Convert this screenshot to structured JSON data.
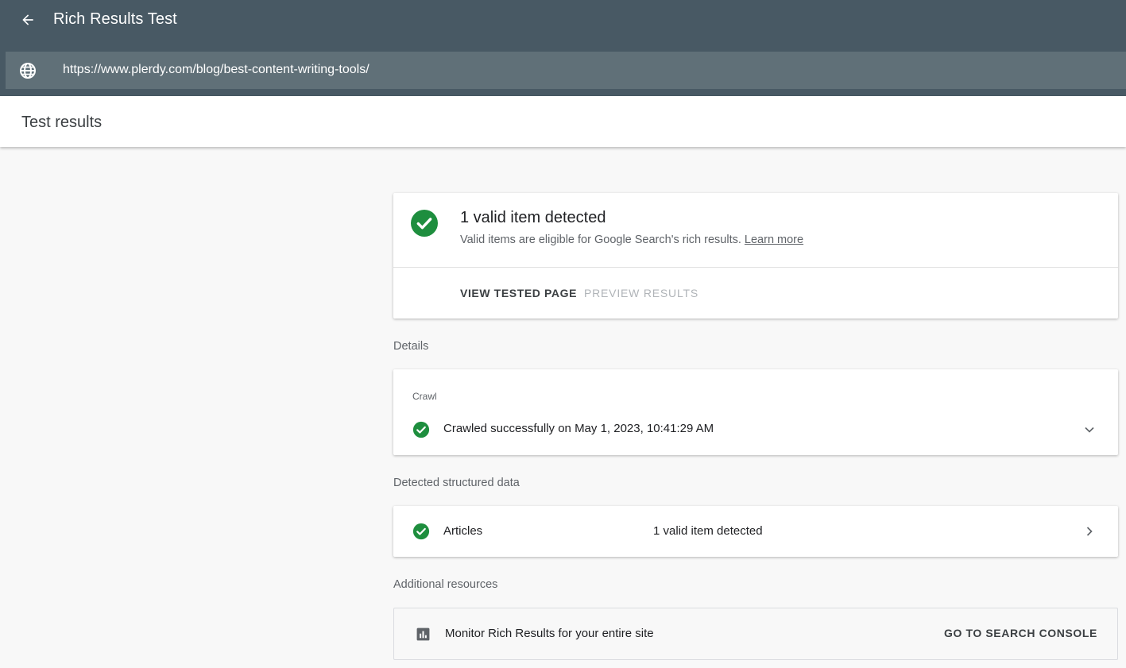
{
  "header": {
    "back_icon": "arrow-back-icon",
    "title": "Rich Results Test",
    "url_icon": "globe-icon",
    "url": "https://www.plerdy.com/blog/best-content-writing-tools/"
  },
  "subheader": {
    "title": "Test results"
  },
  "summary": {
    "icon": "check-circle-icon",
    "title": "1 valid item detected",
    "subtitle": "Valid items are eligible for Google Search's rich results.",
    "learn_more": "Learn more",
    "tabs": [
      {
        "label": "VIEW TESTED PAGE",
        "active": true
      },
      {
        "label": "PREVIEW RESULTS",
        "active": false
      }
    ]
  },
  "details": {
    "section_label": "Details",
    "crawl_label": "Crawl",
    "crawl_status": "Crawled successfully on May 1, 2023, 10:41:29 AM",
    "expand_icon": "chevron-down-icon"
  },
  "structured_data": {
    "section_label": "Detected structured data",
    "items": [
      {
        "type": "Articles",
        "status": "1 valid item detected"
      }
    ],
    "open_icon": "chevron-right-icon"
  },
  "resources": {
    "section_label": "Additional resources",
    "icon": "bar-chart-icon",
    "text": "Monitor Rich Results for your entire site",
    "button": "GO TO SEARCH CONSOLE"
  },
  "colors": {
    "header_bg": "#485964",
    "url_bar_bg": "#607078",
    "success_green": "#1e8e3e",
    "page_bg": "#f8f8f8"
  }
}
